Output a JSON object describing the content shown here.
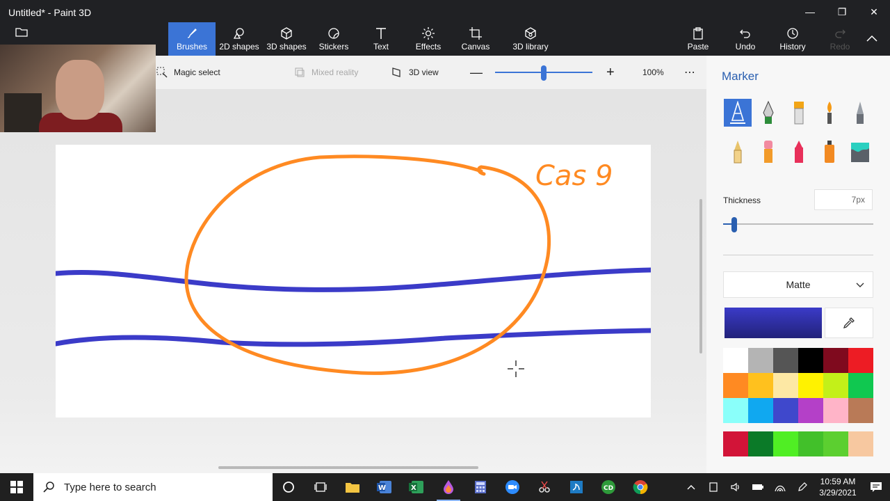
{
  "window": {
    "title": "Untitled* - Paint 3D"
  },
  "ribbon": {
    "tools": [
      {
        "label": "Brushes",
        "icon": "brush-icon"
      },
      {
        "label": "2D shapes",
        "icon": "2d-shapes-icon"
      },
      {
        "label": "3D shapes",
        "icon": "3d-shapes-icon"
      },
      {
        "label": "Stickers",
        "icon": "stickers-icon"
      },
      {
        "label": "Text",
        "icon": "text-icon"
      },
      {
        "label": "Effects",
        "icon": "effects-icon"
      },
      {
        "label": "Canvas",
        "icon": "canvas-icon"
      },
      {
        "label": "3D library",
        "icon": "3d-library-icon"
      }
    ],
    "right_tools": [
      {
        "label": "Paste",
        "icon": "paste-icon"
      },
      {
        "label": "Undo",
        "icon": "undo-icon"
      },
      {
        "label": "History",
        "icon": "history-icon"
      },
      {
        "label": "Redo",
        "icon": "redo-icon"
      }
    ]
  },
  "subbar": {
    "magic_select": "Magic select",
    "mixed_reality": "Mixed reality",
    "view_3d": "3D view",
    "zoom": "100%",
    "zoom_level": 0.5
  },
  "canvas_text": "Cas 9",
  "panel": {
    "title": "Marker",
    "thickness_label": "Thickness",
    "thickness_value": "7px",
    "finish": "Matte",
    "current_color": "#3b3bc8",
    "brushes": [
      "marker-icon",
      "calligraphy-pen-icon",
      "oil-brush-icon",
      "watercolor-icon",
      "pixel-pen-icon",
      "pencil-icon",
      "eraser-icon",
      "crayon-icon",
      "spray-can-icon",
      "fill-bucket-icon"
    ],
    "palette": [
      "#ffffff",
      "#b4b4b4",
      "#555555",
      "#000000",
      "#7f0a1e",
      "#ed1c24",
      "#ff8a22",
      "#ffc11e",
      "#fde8a4",
      "#fff200",
      "#c3f019",
      "#10c850",
      "#8afffa",
      "#10a8f0",
      "#3f48cc",
      "#b440c8",
      "#ffb4c8",
      "#b97a57"
    ],
    "custom_palette": [
      "#d21438",
      "#0b7a28",
      "#50ee24",
      "#42c02a",
      "#5ccf30",
      "#f7c8a0"
    ]
  },
  "taskbar": {
    "search_placeholder": "Type here to search",
    "time": "10:59 AM",
    "date": "3/29/2021"
  }
}
